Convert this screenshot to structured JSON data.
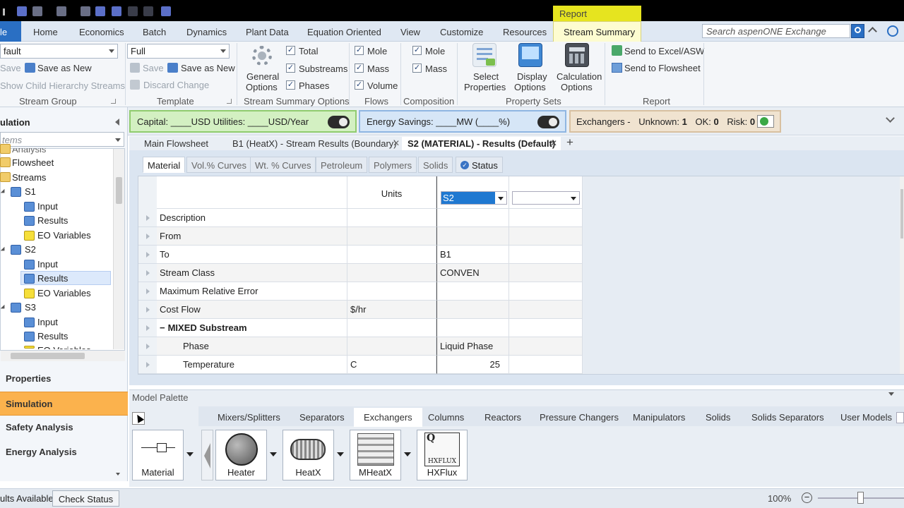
{
  "window": {
    "contextual_tab_group": "Report"
  },
  "menu": {
    "file_label": "le",
    "tabs": [
      "Home",
      "Economics",
      "Batch",
      "Dynamics",
      "Plant Data",
      "Equation Oriented",
      "View",
      "Customize",
      "Resources"
    ],
    "active_tab": "Stream Summary",
    "search_placeholder": "Search aspenONE Exchange"
  },
  "ribbon": {
    "stream_group": {
      "combo_value": "fault",
      "save": "Save",
      "save_as_new": "Save as New",
      "show_child": "Show Child Hierarchy Streams",
      "label": "Stream Group"
    },
    "template": {
      "combo_value": "Full",
      "save": "Save",
      "save_as_new": "Save as New",
      "discard": "Discard Change",
      "label": "Template"
    },
    "general_options": {
      "line1": "General",
      "line2": "Options"
    },
    "stream_summary_options": {
      "total": "Total",
      "substreams": "Substreams",
      "phases": "Phases",
      "label": "Stream Summary Options"
    },
    "flows": {
      "mole": "Mole",
      "mass": "Mass",
      "volume": "Volume",
      "label": "Flows"
    },
    "composition": {
      "mole": "Mole",
      "mass": "Mass",
      "label": "Composition"
    },
    "property_sets": {
      "select_1": "Select",
      "select_2": "Properties",
      "display_1": "Display",
      "display_2": "Options",
      "calc_1": "Calculation",
      "calc_2": "Options",
      "label": "Property Sets"
    },
    "report": {
      "excel": "Send to Excel/ASW",
      "flowsheet": "Send to Flowsheet",
      "label": "Report"
    }
  },
  "status": {
    "capital": "Capital: ____USD   Utilities: ____USD/Year",
    "energy": "Energy Savings: ____MW     (____%)",
    "exchangers_label": "Exchangers -",
    "unknown_label": "Unknown:",
    "unknown_value": "1",
    "ok_label": "OK:",
    "ok_value": "0",
    "risk_label": "Risk:",
    "risk_value": "0"
  },
  "nav": {
    "title": "ulation",
    "filter_placeholder": "tems",
    "tree": {
      "analysis": "Analysis",
      "flowsheet": "Flowsheet",
      "streams": "Streams",
      "s1": "S1",
      "s1_input": "Input",
      "s1_results": "Results",
      "s1_eo": "EO Variables",
      "s2": "S2",
      "s2_input": "Input",
      "s2_results": "Results",
      "s2_eo": "EO Variables",
      "s3": "S3",
      "s3_input": "Input",
      "s3_results": "Results",
      "s3_eo": "EO Variables"
    },
    "buttons": {
      "properties": "Properties",
      "simulation": "Simulation",
      "safety": "Safety Analysis",
      "energy": "Energy Analysis"
    }
  },
  "doc_tabs": [
    "Main Flowsheet",
    "B1 (HeatX) - Stream Results (Boundary)",
    "S2 (MATERIAL) - Results (Default)"
  ],
  "sub_tabs": [
    "Material",
    "Vol.% Curves",
    "Wt. % Curves",
    "Petroleum",
    "Polymers",
    "Solids",
    "Status"
  ],
  "grid": {
    "units_header": "Units",
    "stream_select": "S2",
    "rows": [
      {
        "label": "Description",
        "units": "",
        "value": ""
      },
      {
        "label": "From",
        "units": "",
        "value": ""
      },
      {
        "label": "To",
        "units": "",
        "value": "B1"
      },
      {
        "label": "Stream Class",
        "units": "",
        "value": "CONVEN"
      },
      {
        "label": "Maximum Relative Error",
        "units": "",
        "value": ""
      },
      {
        "label": "Cost Flow",
        "units": "$/hr",
        "value": ""
      },
      {
        "label": "MIXED Substream",
        "units": "",
        "value": ""
      },
      {
        "label": "Phase",
        "units": "",
        "value": "Liquid Phase"
      },
      {
        "label": "Temperature",
        "units": "C",
        "value": "25"
      }
    ]
  },
  "palette": {
    "title": "Model Palette",
    "tabs": [
      "Mixers/Splitters",
      "Separators",
      "Exchangers",
      "Columns",
      "Reactors",
      "Pressure Changers",
      "Manipulators",
      "Solids",
      "Solids Separators",
      "User Models"
    ],
    "material": "Material",
    "models": [
      "Heater",
      "HeatX",
      "MHeatX",
      "HXFlux"
    ],
    "hxflux_icon_q": "Q",
    "hxflux_icon_text": "HXFLUX"
  },
  "statusbar": {
    "results": "ults Available",
    "check_status": "Check Status",
    "zoom": "100%"
  },
  "colors": {
    "accent_blue": "#2a6fc3",
    "simulation_orange": "#fbb24d",
    "report_yellow": "#e6e41f"
  }
}
